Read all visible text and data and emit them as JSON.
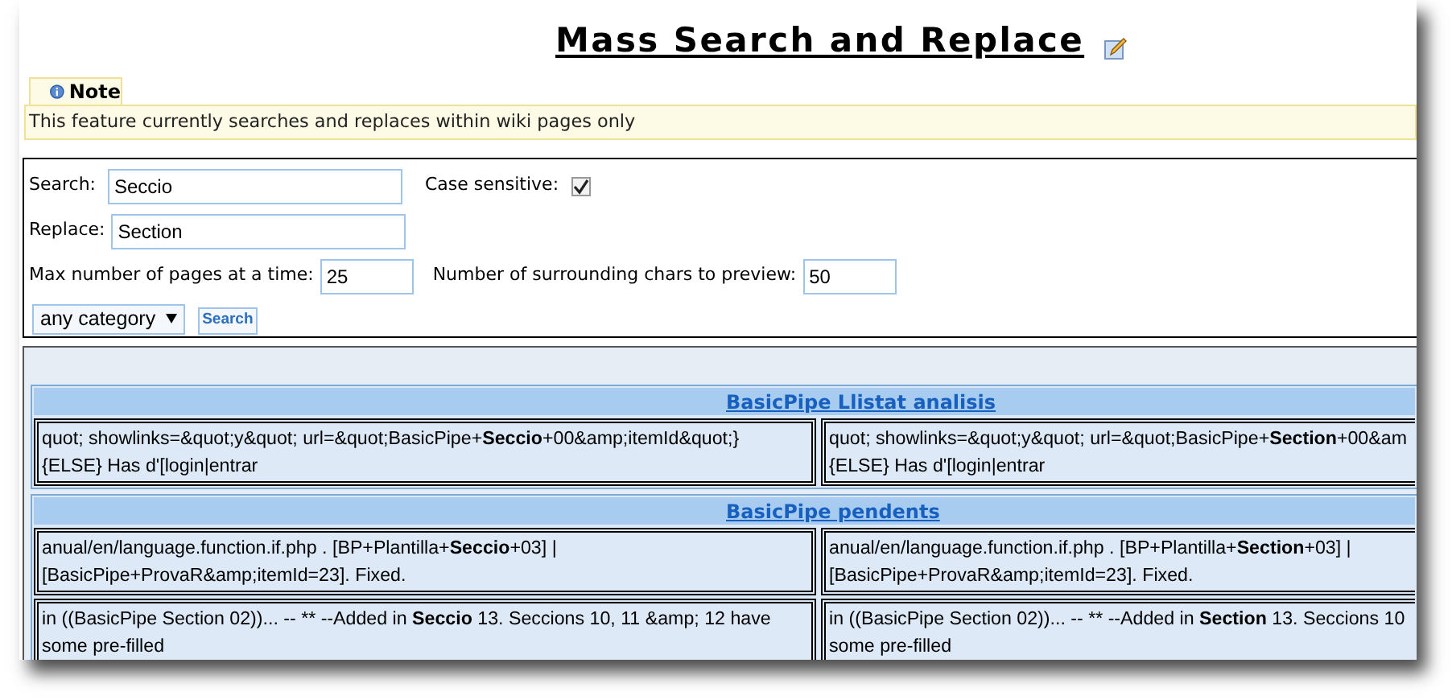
{
  "title": "Mass Search and Replace",
  "note": {
    "label": "Note",
    "text": "This feature currently searches and replaces within wiki pages only"
  },
  "form": {
    "search_label": "Search:",
    "search_value": "Seccio",
    "case_label": "Case sensitive:",
    "case_checked": true,
    "replace_label": "Replace:",
    "replace_value": "Section",
    "max_label": "Max number of pages at a time:",
    "max_value": "25",
    "chars_label": "Number of surrounding chars to preview:",
    "chars_value": "50",
    "category": "any category",
    "search_button": "Search"
  },
  "results": [
    {
      "title": "BasicPipe Llistat analisis",
      "rows": [
        {
          "original": [
            "quot; showlinks=&quot;y&quot; url=&quot;BasicPipe+**Seccio**+00&amp;itemId&quot;}",
            "{ELSE} Has d'[login|entrar"
          ],
          "replaced": [
            "quot; showlinks=&quot;y&quot; url=&quot;BasicPipe+**Section**+00&am",
            "{ELSE} Has d'[login|entrar"
          ]
        }
      ]
    },
    {
      "title": "BasicPipe pendents",
      "rows": [
        {
          "original": [
            "anual/en/language.function.if.php . [BP+Plantilla+**Seccio**+03] |",
            "[BasicPipe+ProvaR&amp;itemId=23]. Fixed."
          ],
          "replaced": [
            "anual/en/language.function.if.php . [BP+Plantilla+**Section**+03] |",
            "[BasicPipe+ProvaR&amp;itemId=23]. Fixed."
          ]
        },
        {
          "original": [
            "in ((BasicPipe Section 02))... -- ** --Added in **Seccio** 13. Seccions 10, 11 &amp; 12 have",
            "some pre-filled"
          ],
          "replaced": [
            "in ((BasicPipe Section 02))... -- ** --Added in **Section** 13. Seccions 10",
            "some pre-filled"
          ]
        }
      ]
    }
  ]
}
